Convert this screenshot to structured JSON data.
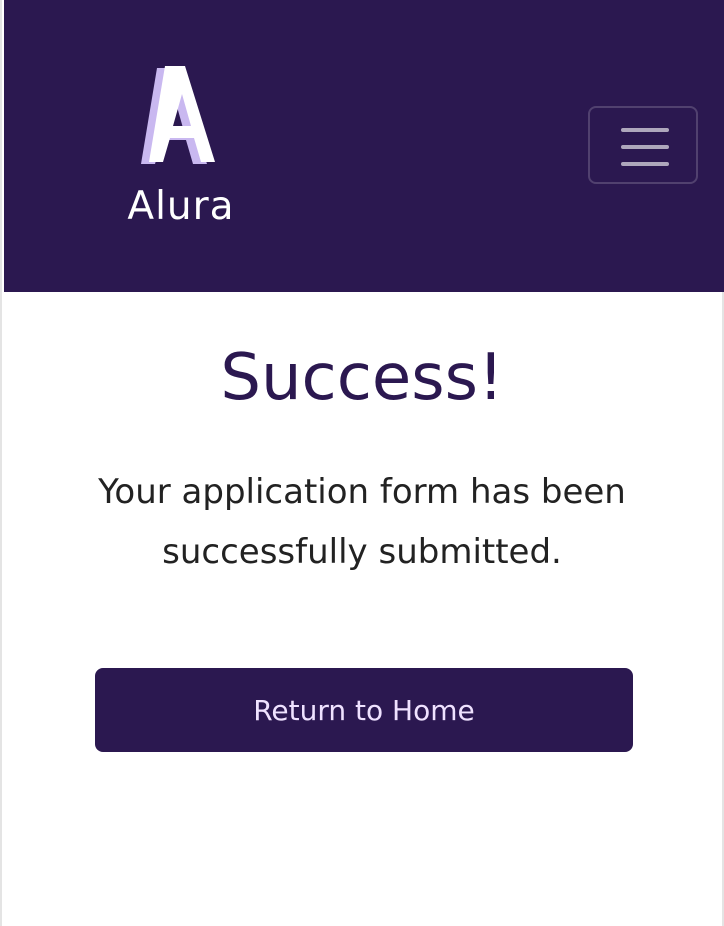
{
  "brand": {
    "logo_letter": "A",
    "name": "Alura"
  },
  "navbar": {
    "toggle_icon": "hamburger-menu-icon"
  },
  "main": {
    "title": "Success!",
    "message": "Your application form has been successfully submitted.",
    "home_button_label": "Return to Home"
  },
  "colors": {
    "brand_primary": "#2b1850",
    "button_text": "#efe2ff",
    "logo_shadow": "#c9b8f0"
  }
}
